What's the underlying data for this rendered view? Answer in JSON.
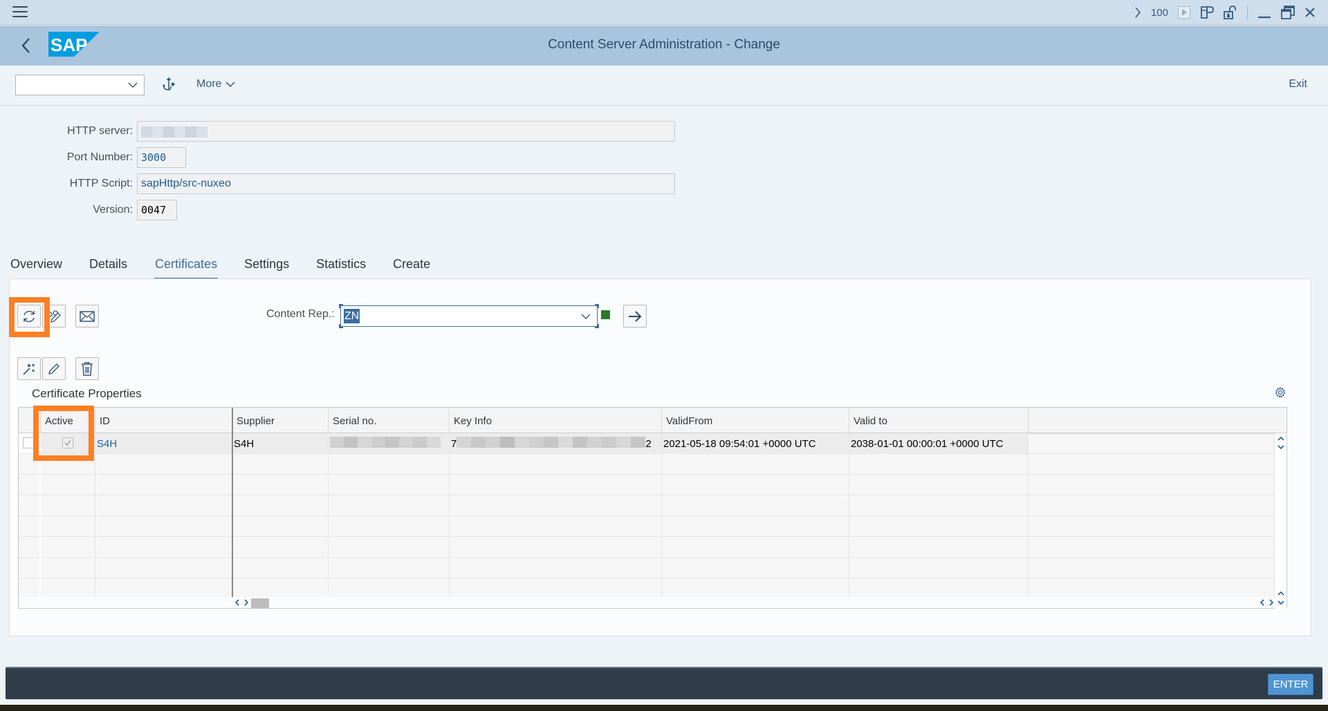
{
  "system_bar": {
    "zoom_value": "100",
    "icons": [
      "chevron-right-icon",
      "play-icon",
      "layout-icon",
      "unlock-icon",
      "minimize-icon",
      "restore-icon",
      "close-icon"
    ]
  },
  "shell": {
    "logo_text": "SAP",
    "title": "Content Server Administration - Change"
  },
  "toolbar": {
    "command_field_value": "",
    "more_label": "More",
    "exit_label": "Exit"
  },
  "form": {
    "http_server": {
      "label": "HTTP server:",
      "value": ""
    },
    "port_number": {
      "label": "Port Number:",
      "value": "3000"
    },
    "http_script": {
      "label": "HTTP Script:",
      "value": "sapHttp/src-nuxeo"
    },
    "version": {
      "label": "Version:",
      "value": "0047"
    }
  },
  "tabs": [
    {
      "label": "Overview",
      "active": false
    },
    {
      "label": "Details",
      "active": false
    },
    {
      "label": "Certificates",
      "active": true
    },
    {
      "label": "Settings",
      "active": false
    },
    {
      "label": "Statistics",
      "active": false
    },
    {
      "label": "Create",
      "active": false
    }
  ],
  "certificates": {
    "content_rep_label": "Content Rep.:",
    "content_rep_value": "ZN",
    "status_color": "#2c7a2c",
    "grid_title": "Certificate Properties",
    "columns": [
      "Active",
      "ID",
      "Supplier",
      "Serial no.",
      "Key Info",
      "ValidFrom",
      "Valid to"
    ],
    "rows": [
      {
        "active": true,
        "id": "S4H",
        "supplier": "S4H",
        "serial_no_prefix": "",
        "key_info_prefix": "7",
        "key_info_suffix": "2",
        "valid_from": "2021-05-18 09:54:01 +0000 UTC",
        "valid_to": "2038-01-01 00:00:01 +0000 UTC"
      }
    ],
    "empty_rows": 7
  },
  "statusbar": {
    "enter_label": "ENTER"
  },
  "colors": {
    "highlight": "#ff7f24",
    "shell_bg": "#a9c5de",
    "accent": "#3f6d96"
  }
}
